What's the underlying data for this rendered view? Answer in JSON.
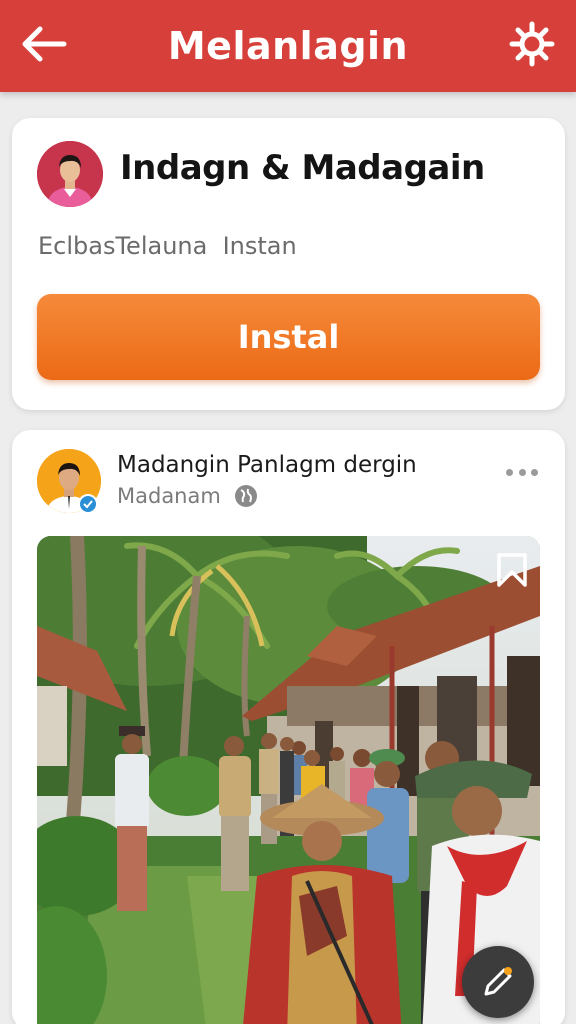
{
  "header": {
    "title": "Melanlagin",
    "back_icon": "arrow-left-icon",
    "settings_icon": "gear-icon",
    "color": "#d7403a"
  },
  "app_card": {
    "title": "Indagn & Madagain",
    "subtitle": "EclbasTelauna  Instan",
    "install_label": "Instal",
    "button_color": "#ef7322"
  },
  "post": {
    "author": "Madangin Panlagm dergin",
    "meta": "Madanam",
    "privacy_icon": "globe-icon",
    "verified_icon": "verified-check-icon",
    "more_icon": "more-dots-icon",
    "bookmark_icon": "bookmark-icon",
    "image_description_icon": "photo"
  },
  "fab": {
    "icon": "edit-pencil-icon"
  }
}
